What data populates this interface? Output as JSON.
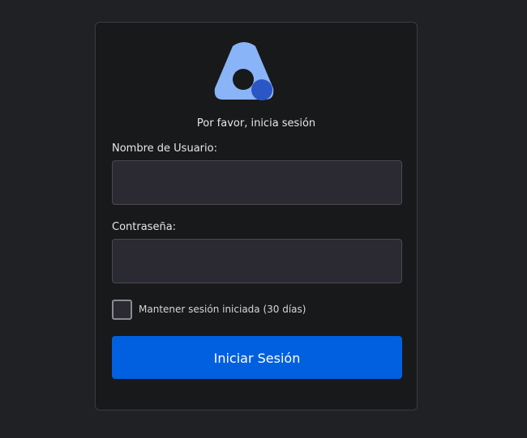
{
  "login": {
    "subtitle": "Por favor, inicia sesión",
    "username_label": "Nombre de Usuario:",
    "username_value": "",
    "password_label": "Contraseña:",
    "password_value": "",
    "remember_label": "Mantener sesión iniciada (30 días)",
    "remember_checked": false,
    "submit_label": "Iniciar Sesión"
  },
  "colors": {
    "page_bg": "#202124",
    "card_bg": "#18191b",
    "input_bg": "#2b2a33",
    "primary": "#0060df",
    "logo_light": "#8ab4f8",
    "logo_dark": "#2a56c6"
  },
  "icons": {
    "logo": "app-logo-icon"
  }
}
